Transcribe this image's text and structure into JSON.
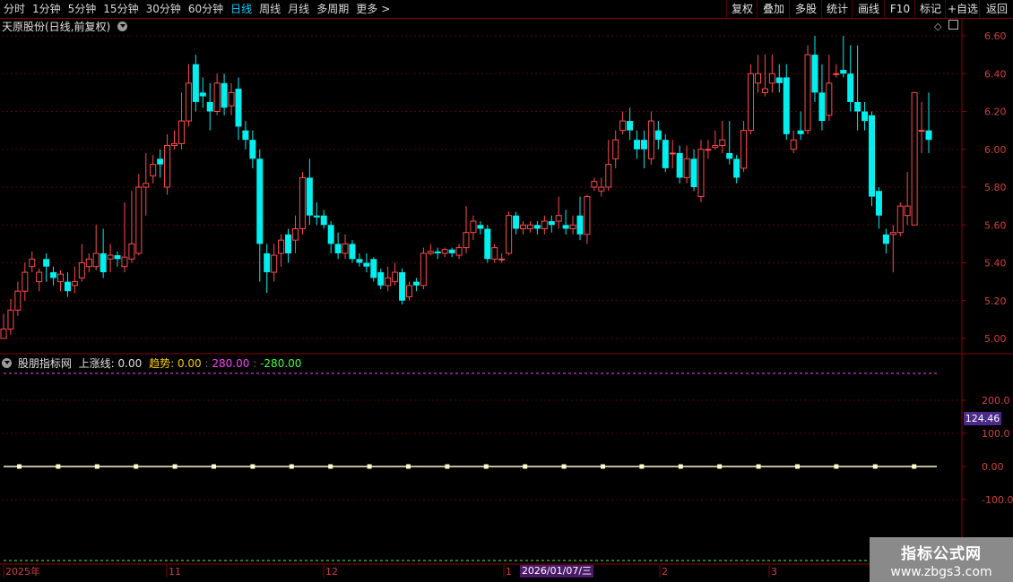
{
  "toolbar": {
    "tabs": [
      "分时",
      "1分钟",
      "5分钟",
      "15分钟",
      "30分钟",
      "60分钟",
      "日线",
      "周线",
      "月线",
      "多周期",
      "更多"
    ],
    "active_tab": "日线",
    "more_arrow": ">",
    "right_buttons": [
      "复权",
      "叠加",
      "多股",
      "统计",
      "画线",
      "F10",
      "标记",
      "+自选",
      "返回"
    ]
  },
  "main_panel": {
    "title": "天原股份(日线,前复权)",
    "y_ticks": [
      "6.60",
      "6.40",
      "6.20",
      "6.00",
      "5.80",
      "5.60",
      "5.40",
      "5.20",
      "5.00"
    ],
    "icons": [
      "diamond-icon",
      "window-icon"
    ]
  },
  "indicator_panel": {
    "name": "股朋指标网",
    "label1": "上涨线:",
    "value1": "0.00",
    "label2": "趋势:",
    "value2": "0.00",
    "value3": "280.00",
    "value4": "-280.00",
    "y_ticks": [
      "200.0",
      "100.0",
      "0.00",
      "-100.0"
    ],
    "cursor_value": "124.46",
    "colors": {
      "label2": "#ffcc00",
      "value3": "#ff40ff",
      "value4": "#40ff40"
    }
  },
  "time_axis": {
    "labels": [
      "2025年",
      "11",
      "12",
      "1",
      "2",
      "3"
    ],
    "cursor_date": "2026/01/07/三"
  },
  "watermark": {
    "line1": "指标公式网",
    "line2": "www.zbgs3.com"
  },
  "chart_data": {
    "type": "candlestick",
    "y_range": [
      5.0,
      6.6
    ],
    "up_color": "#ff4a4a",
    "down_color": "#00f0f0",
    "candles": [
      [
        5.0,
        5.05,
        5.0,
        5.13
      ],
      [
        5.05,
        5.15,
        5.02,
        5.21
      ],
      [
        5.15,
        5.25,
        5.12,
        5.3
      ],
      [
        5.25,
        5.35,
        5.2,
        5.4
      ],
      [
        5.38,
        5.42,
        5.35,
        5.46
      ],
      [
        5.3,
        5.35,
        5.25,
        5.37
      ],
      [
        5.42,
        5.38,
        5.3,
        5.45
      ],
      [
        5.35,
        5.32,
        5.28,
        5.38
      ],
      [
        5.3,
        5.34,
        5.25,
        5.36
      ],
      [
        5.3,
        5.25,
        5.22,
        5.35
      ],
      [
        5.28,
        5.3,
        5.24,
        5.38
      ],
      [
        5.32,
        5.4,
        5.3,
        5.5
      ],
      [
        5.38,
        5.42,
        5.35,
        5.45
      ],
      [
        5.38,
        5.45,
        5.36,
        5.6
      ],
      [
        5.45,
        5.35,
        5.32,
        5.58
      ],
      [
        5.42,
        5.44,
        5.35,
        5.5
      ],
      [
        5.44,
        5.42,
        5.38,
        5.46
      ],
      [
        5.38,
        5.43,
        5.35,
        5.72
      ],
      [
        5.42,
        5.5,
        5.4,
        5.78
      ],
      [
        5.45,
        5.8,
        5.44,
        5.87
      ],
      [
        5.8,
        5.82,
        5.65,
        5.98
      ],
      [
        5.86,
        5.92,
        5.82,
        5.97
      ],
      [
        5.95,
        5.92,
        5.85,
        6.0
      ],
      [
        5.8,
        6.02,
        5.76,
        6.08
      ],
      [
        6.02,
        6.03,
        6.0,
        6.1
      ],
      [
        6.03,
        6.15,
        6.0,
        6.3
      ],
      [
        6.15,
        6.35,
        6.12,
        6.45
      ],
      [
        6.45,
        6.25,
        6.2,
        6.5
      ],
      [
        6.3,
        6.28,
        6.22,
        6.38
      ],
      [
        6.25,
        6.2,
        6.1,
        6.35
      ],
      [
        6.2,
        6.35,
        6.18,
        6.4
      ],
      [
        6.35,
        6.22,
        6.18,
        6.4
      ],
      [
        6.23,
        6.3,
        6.18,
        6.35
      ],
      [
        6.32,
        6.12,
        6.05,
        6.38
      ],
      [
        6.1,
        6.05,
        6.0,
        6.15
      ],
      [
        6.05,
        5.95,
        5.9,
        6.1
      ],
      [
        5.95,
        5.5,
        5.3,
        6.0
      ],
      [
        5.45,
        5.35,
        5.24,
        5.5
      ],
      [
        5.35,
        5.44,
        5.3,
        5.5
      ],
      [
        5.45,
        5.52,
        5.38,
        5.55
      ],
      [
        5.55,
        5.45,
        5.4,
        5.58
      ],
      [
        5.52,
        5.58,
        5.45,
        5.65
      ],
      [
        5.58,
        5.85,
        5.55,
        5.88
      ],
      [
        5.85,
        5.65,
        5.6,
        5.95
      ],
      [
        5.65,
        5.64,
        5.6,
        5.72
      ],
      [
        5.65,
        5.6,
        5.58,
        5.68
      ],
      [
        5.6,
        5.5,
        5.45,
        5.62
      ],
      [
        5.5,
        5.45,
        5.42,
        5.56
      ],
      [
        5.45,
        5.5,
        5.42,
        5.55
      ],
      [
        5.5,
        5.42,
        5.4,
        5.52
      ],
      [
        5.42,
        5.4,
        5.38,
        5.45
      ],
      [
        5.4,
        5.38,
        5.35,
        5.45
      ],
      [
        5.42,
        5.32,
        5.3,
        5.43
      ],
      [
        5.35,
        5.28,
        5.26,
        5.37
      ],
      [
        5.28,
        5.32,
        5.25,
        5.38
      ],
      [
        5.3,
        5.35,
        5.28,
        5.4
      ],
      [
        5.35,
        5.2,
        5.18,
        5.37
      ],
      [
        5.22,
        5.28,
        5.2,
        5.3
      ],
      [
        5.3,
        5.28,
        5.25,
        5.32
      ],
      [
        5.28,
        5.45,
        5.26,
        5.48
      ],
      [
        5.45,
        5.46,
        5.44,
        5.5
      ],
      [
        5.46,
        5.45,
        5.42,
        5.48
      ],
      [
        5.45,
        5.47,
        5.43,
        5.48
      ],
      [
        5.47,
        5.45,
        5.43,
        5.48
      ],
      [
        5.44,
        5.48,
        5.42,
        5.5
      ],
      [
        5.48,
        5.56,
        5.45,
        5.7
      ],
      [
        5.56,
        5.62,
        5.52,
        5.65
      ],
      [
        5.6,
        5.58,
        5.55,
        5.62
      ],
      [
        5.58,
        5.42,
        5.4,
        5.6
      ],
      [
        5.42,
        5.48,
        5.4,
        5.5
      ],
      [
        5.42,
        5.42,
        5.4,
        5.45
      ],
      [
        5.45,
        5.65,
        5.44,
        5.67
      ],
      [
        5.65,
        5.58,
        5.55,
        5.67
      ],
      [
        5.58,
        5.6,
        5.55,
        5.62
      ],
      [
        5.58,
        5.6,
        5.56,
        5.62
      ],
      [
        5.6,
        5.58,
        5.55,
        5.62
      ],
      [
        5.58,
        5.62,
        5.55,
        5.65
      ],
      [
        5.62,
        5.6,
        5.56,
        5.65
      ],
      [
        5.62,
        5.65,
        5.58,
        5.75
      ],
      [
        5.6,
        5.58,
        5.55,
        5.68
      ],
      [
        5.58,
        5.6,
        5.55,
        5.65
      ],
      [
        5.65,
        5.55,
        5.52,
        5.75
      ],
      [
        5.55,
        5.75,
        5.5,
        5.76
      ],
      [
        5.8,
        5.83,
        5.78,
        5.85
      ],
      [
        5.78,
        5.8,
        5.75,
        5.85
      ],
      [
        5.8,
        5.92,
        5.78,
        6.05
      ],
      [
        5.95,
        6.05,
        5.9,
        6.1
      ],
      [
        6.1,
        6.15,
        6.08,
        6.2
      ],
      [
        6.15,
        6.1,
        6.05,
        6.22
      ],
      [
        6.05,
        6.0,
        5.95,
        6.1
      ],
      [
        6.05,
        6.0,
        5.9,
        6.1
      ],
      [
        5.95,
        6.15,
        5.92,
        6.2
      ],
      [
        6.1,
        6.05,
        6.0,
        6.15
      ],
      [
        6.05,
        5.9,
        5.88,
        6.08
      ],
      [
        5.98,
        5.98,
        5.9,
        6.05
      ],
      [
        5.98,
        5.85,
        5.82,
        6.02
      ],
      [
        5.85,
        5.95,
        5.82,
        6.02
      ],
      [
        5.95,
        5.8,
        5.78,
        6.0
      ],
      [
        5.75,
        6.0,
        5.72,
        6.05
      ],
      [
        6.0,
        6.0,
        5.95,
        6.05
      ],
      [
        6.01,
        6.02,
        6.0,
        6.1
      ],
      [
        6.02,
        6.05,
        5.98,
        6.15
      ],
      [
        5.98,
        5.95,
        5.92,
        6.15
      ],
      [
        5.95,
        5.85,
        5.82,
        5.97
      ],
      [
        5.9,
        6.1,
        5.88,
        6.15
      ],
      [
        6.1,
        6.4,
        6.08,
        6.45
      ],
      [
        6.35,
        6.4,
        6.3,
        6.5
      ],
      [
        6.3,
        6.32,
        6.28,
        6.5
      ],
      [
        6.35,
        6.4,
        6.3,
        6.5
      ],
      [
        6.38,
        6.35,
        6.3,
        6.45
      ],
      [
        6.38,
        6.08,
        6.05,
        6.45
      ],
      [
        6.0,
        6.05,
        5.98,
        6.1
      ],
      [
        6.1,
        6.08,
        6.05,
        6.2
      ],
      [
        6.1,
        6.5,
        6.08,
        6.55
      ],
      [
        6.5,
        6.3,
        6.25,
        6.6
      ],
      [
        6.3,
        6.15,
        6.1,
        6.45
      ],
      [
        6.18,
        6.35,
        6.15,
        6.5
      ],
      [
        6.4,
        6.4,
        6.38,
        6.45
      ],
      [
        6.42,
        6.4,
        6.38,
        6.6
      ],
      [
        6.4,
        6.25,
        6.2,
        6.55
      ],
      [
        6.25,
        6.2,
        6.1,
        6.55
      ],
      [
        6.2,
        6.15,
        6.1,
        6.25
      ],
      [
        6.18,
        5.75,
        5.7,
        6.2
      ],
      [
        5.78,
        5.65,
        5.58,
        5.8
      ],
      [
        5.55,
        5.5,
        5.45,
        5.58
      ],
      [
        5.55,
        5.56,
        5.35,
        5.6
      ],
      [
        5.56,
        5.7,
        5.54,
        5.72
      ],
      [
        5.65,
        5.7,
        5.6,
        5.88
      ],
      [
        5.6,
        6.3,
        5.6,
        6.3
      ],
      [
        6.1,
        6.1,
        5.98,
        6.25
      ],
      [
        6.1,
        6.05,
        5.98,
        6.3
      ]
    ]
  }
}
